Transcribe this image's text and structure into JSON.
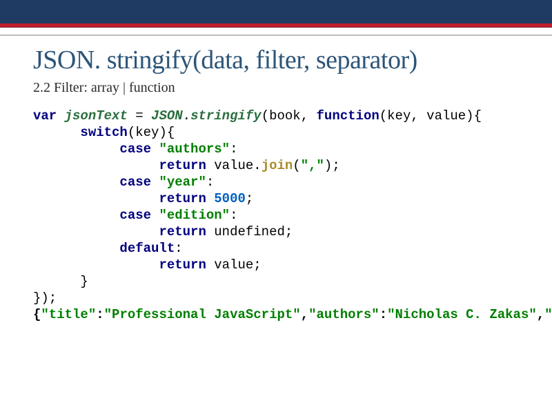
{
  "header": {
    "title": "JSON. stringify(data, filter, separator)",
    "subtitle": "2.2 Filter: array | function"
  },
  "code": {
    "var": "var",
    "jsonText": "jsonText",
    "eq": " = ",
    "JSON": "JSON",
    "dot1": ".",
    "stringify": "stringify",
    "open_args": "(book, ",
    "function": "function",
    "fn_params": "(key, value){",
    "switch": "switch",
    "switch_expr": "(key){",
    "case": "case",
    "str_authors": "\"authors\"",
    "colon": ":",
    "return": "return",
    "value_dot": " value.",
    "join": "join",
    "join_arg_open": "(",
    "str_comma": "\",\"",
    "join_arg_close": ");",
    "str_year": "\"year\"",
    "return_5000": " ",
    "num_5000": "5000",
    "semicolon": ";",
    "str_edition": "\"edition\"",
    "return_undef": " undefined;",
    "default": "default",
    "return_value": " value;",
    "close_switch": "      }",
    "close_fn": "});",
    "out_open": "{",
    "out_title_k": "\"title\"",
    "out_title_v": "\"Professional JavaScript\"",
    "out_authors_k": "\"authors\"",
    "out_authors_v": "\"Nicholas C. Zakas\"",
    "comma": ",",
    "out_year_k": "\"year\"",
    "out_close": "})"
  }
}
